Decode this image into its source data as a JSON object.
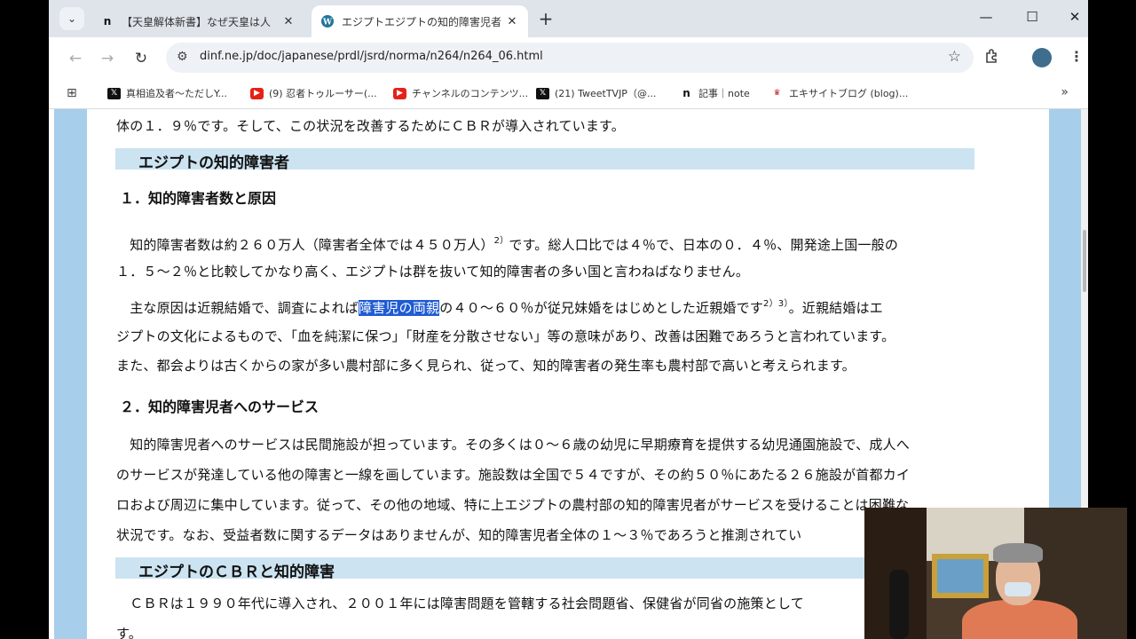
{
  "browser": {
    "tabs": [
      {
        "title": "【天皇解体新書】なぜ天皇は人",
        "favicon": "n",
        "active": false
      },
      {
        "title": "エジプトエジプトの知的障害児者と",
        "favicon": "wordpress",
        "active": true
      }
    ],
    "new_tab_label": "+",
    "window_controls": {
      "minimize": "—",
      "maximize": "☐",
      "close": "✕"
    },
    "url": "dinf.ne.jp/doc/japanese/prdl/jsrd/norma/n264/n264_06.html",
    "bookmarks": [
      {
        "label": "真相追及者〜ただしY...",
        "icon": "x-icon"
      },
      {
        "label": "(9) 忍者トゥルーサー(...",
        "icon": "youtube-icon"
      },
      {
        "label": "チャンネルのコンテンツ...",
        "icon": "youtube-icon"
      },
      {
        "label": "(21) TweetTVJP（@...",
        "icon": "x-icon"
      },
      {
        "label": "記事｜note",
        "icon": "note-icon"
      },
      {
        "label": "エキサイトブログ (blog)...",
        "icon": "excite-icon"
      }
    ],
    "bookmarks_overflow": "»"
  },
  "document": {
    "line0": "体の１．９％です。そして、この状況を改善するためにＣＢＲが導入されています。",
    "section1_heading": "エジプトの知的障害者",
    "sub1": "１．知的障害者数と原因",
    "p1_l1_a": "　知的障害者数は約２６０万人（障害者全体では４５０万人）",
    "p1_sup": "2）",
    "p1_l1_b": "です。総人口比では４％で、日本の０．４％、開発途上国一般の",
    "p1_l2": "１．５〜２％と比較してかなり高く、エジプトは群を抜いて知的障害者の多い国と言わねばなりません。",
    "p2_l1_a": "　主な原因は近親結婚で、調査によれば",
    "p2_highlight": "障害児の両親",
    "p2_l1_b": "の４０〜６０％が従兄妹婚をはじめとした近親婚です",
    "p2_sup": "2）3）",
    "p2_l1_c": "。近親結婚はエ",
    "p2_l2": "ジプトの文化によるもので、「血を純潔に保つ」「財産を分散させない」等の意味があり、改善は困難であろうと言われています。",
    "p2_l3": "また、都会よりは古くからの家が多い農村部に多く見られ、従って、知的障害者の発生率も農村部で高いと考えられます。",
    "sub2": "２．知的障害児者へのサービス",
    "p3_l1": "　知的障害児者へのサービスは民間施設が担っています。その多くは０〜６歳の幼児に早期療育を提供する幼児通園施設で、成人へ",
    "p3_l2": "のサービスが発達している他の障害と一線を画しています。施設数は全国で５４ですが、その約５０％にあたる２６施設が首都カイ",
    "p3_l3": "ロおよび周辺に集中しています。従って、その他の地域、特に上エジプトの農村部の知的障害児者がサービスを受けることは困難な",
    "p3_l4": "状況です。なお、受益者数に関するデータはありませんが、知的障害児者全体の１〜３％であろうと推測されてい",
    "section2_heading": "エジプトのＣＢＲと知的障害",
    "p4_l1": "　ＣＢＲは１９９０年代に導入され、２００１年には障害問題を管轄する社会問題省、保健省が同省の施策として",
    "p4_l2": "す。"
  },
  "colors": {
    "heading_bar": "#cce3f1",
    "side_background": "#a7ceea",
    "highlight": "#1f5bd3"
  }
}
